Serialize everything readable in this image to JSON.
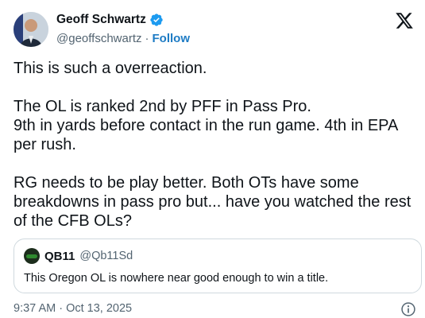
{
  "tweet": {
    "author_name": "Geoff Schwartz",
    "author_handle": "@geoffschwartz",
    "separator": "·",
    "follow_label": "Follow",
    "lines": [
      "This is such a overreaction.",
      "",
      "The OL is ranked 2nd by PFF in Pass Pro.",
      "9th in yards before contact in the run game. 4th in EPA per rush.",
      "",
      "RG needs to be play better. Both OTs have some breakdowns in pass pro but... have you watched the rest of the CFB OLs?"
    ],
    "timestamp": "9:37 AM · Oct 13, 2025"
  },
  "quote": {
    "name": "QB11",
    "handle": "@Qb11Sd",
    "text": "This Oregon OL is nowhere near good enough to win a title."
  },
  "icons": {
    "verified": "verified-badge-icon",
    "logo": "x-logo-icon",
    "info": "info-icon"
  },
  "colors": {
    "verified": "#1d9bf0",
    "follow": "#1d7bc4",
    "text": "#0f1419",
    "secondary": "#536471",
    "border": "#cfd9de"
  }
}
